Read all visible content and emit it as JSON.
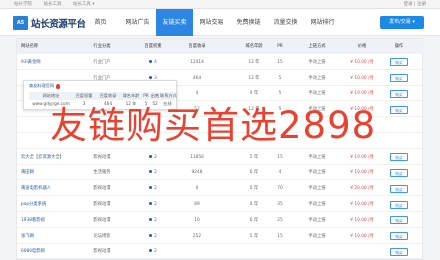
{
  "topbar": {
    "links": [
      "站长学院",
      "站长工具",
      "站长工具 ▾"
    ],
    "right": "登录 | 注册"
  },
  "logo": {
    "mark": "A5",
    "text": "站长资源平台"
  },
  "nav": [
    "首页",
    "网站广告",
    "友链买卖",
    "网站交易",
    "免费换链",
    "流量交换",
    "网站排行"
  ],
  "nav_active_index": 2,
  "publish_button": "发布/交易 ▾",
  "table": {
    "headers": [
      "网站名称",
      "行业分类",
      "百度权重",
      "百度收录",
      "域名年龄",
      "PR",
      "上链方式",
      "价格",
      "操作"
    ],
    "rows": [
      {
        "name": "93i黄金网",
        "cat": "行业门户",
        "w": "4",
        "bd": "12414",
        "age": "12 年",
        "pr": "15",
        "mode": "手动上链",
        "price": "¥ 10.00 /月",
        "op": "购买"
      },
      {
        "name": "",
        "cat": "行业门户",
        "w": "3",
        "bd": "464",
        "age": "12 年",
        "pr": "5",
        "mode": "手动上链",
        "price": "¥ 10.00 /月",
        "op": "购买"
      },
      {
        "name": "",
        "cat": "行业门户",
        "w": "2",
        "bd": "4",
        "age": "4 年",
        "pr": "5",
        "mode": "手动上链",
        "price": "¥ 10.00 /月",
        "op": "购买"
      },
      {
        "name": "",
        "cat": "行业门户",
        "w": "2",
        "bd": "52",
        "age": "12 年",
        "pr": "5",
        "mode": "手动上链",
        "price": "¥ 10.00 /月",
        "op": "购买"
      },
      {
        "name": "",
        "cat": "",
        "w": "",
        "bd": "",
        "age": "",
        "pr": "",
        "mode": "",
        "price": "",
        "op": ""
      },
      {
        "name": "",
        "cat": "",
        "w": "",
        "bd": "",
        "age": "",
        "pr": "",
        "mode": "",
        "price": "",
        "op": ""
      },
      {
        "name": "云大全【云资源大全】",
        "cat": "影视动漫",
        "w": "2",
        "bd": "11856",
        "age": "5 年",
        "pr": "15",
        "mode": "手动上链",
        "price": "¥ 10.00 /月",
        "op": "购买"
      },
      {
        "name": "莆田网",
        "cat": "生活服务",
        "w": "2",
        "bd": "9248",
        "age": "6 年",
        "pr": "4",
        "mode": "手动上链",
        "price": "¥ 10.00 /月",
        "op": "购买"
      },
      {
        "name": "莆迪电影机器人",
        "cat": "影视动漫",
        "w": "2",
        "bd": "0",
        "age": "0 年",
        "pr": "70",
        "mode": "手动上链",
        "price": "¥ 20.00 /月",
        "op": "购买"
      },
      {
        "name": "pop分类系统",
        "cat": "影视动漫",
        "w": "2",
        "bd": "89",
        "age": "4 年",
        "pr": "35",
        "mode": "手动上链",
        "price": "¥ 10.00 /月",
        "op": "购买"
      },
      {
        "name": "1938看影视",
        "cat": "影视动漫",
        "w": "2",
        "bd": "10",
        "age": "6 年",
        "pr": "25",
        "mode": "手动上链",
        "price": "¥ 10.00 /月",
        "op": "购买"
      },
      {
        "name": "张飞网",
        "cat": "论坛博客",
        "w": "2",
        "bd": "252",
        "age": "5 年",
        "pr": "15",
        "mode": "手动上链",
        "price": "¥ 10.00 /月",
        "op": "购买"
      },
      {
        "name": "6080电影网",
        "cat": "影视动漫",
        "w": "2",
        "bd": "",
        "age": "",
        "pr": "",
        "mode": "",
        "price": "",
        "op": "购买"
      }
    ]
  },
  "popup": {
    "title": "森友料理官网",
    "headers": [
      "网站地址",
      "百度权重",
      "百度收录",
      "域名年龄",
      "PR",
      "出售",
      "联系方式"
    ],
    "values": [
      "www.gdyjrge.com",
      "3",
      "464",
      "12 年",
      "5",
      "52",
      "在线"
    ]
  },
  "watermark": "友链购买首选2898"
}
